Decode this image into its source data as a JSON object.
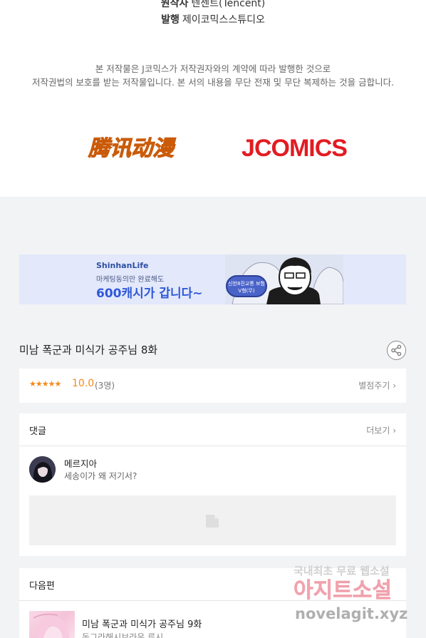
{
  "credits": {
    "author_label": "원작사",
    "author_value": "텐센트(Tencent)",
    "publisher_label": "발행",
    "publisher_value": "제이코믹스스튜디오"
  },
  "notice": {
    "line1": "본 저작물은 J코믹스가 저작권자와의 계약에 따라 발행한 것으로",
    "line2": "저작권법의 보호를 받는 저작물입니다. 본 서의 내용을 무단 전재 및 무단 복제하는 것을 금합니다."
  },
  "logos": {
    "tencent": "腾讯动漫",
    "jcomics": "JCOMICS"
  },
  "banner": {
    "brand": "ShinhanLife",
    "sub": "마케팅동의만 완료해도",
    "main": "600캐시가 갑니다~",
    "pill": "신한8진교통 보험V형(무)"
  },
  "episode": {
    "title": "미남 폭군과 미식가 공주님 8화"
  },
  "rating": {
    "stars": "★★★★★",
    "score": "10.0",
    "votes": "(3명)",
    "rate_link": "별점주기 ›"
  },
  "comments": {
    "header": "댓글",
    "more": "더보기 ›",
    "items": [
      {
        "name": "메르지아",
        "text": "세송이가 왜 저기서?"
      }
    ]
  },
  "next": {
    "header": "다음편",
    "title": "미남 폭군과 미식가 공주님 9화",
    "subtitle": "동그라해시브라운 루시"
  },
  "watermark": {
    "line1": "국내최초 무료 웹소설",
    "line2": "아지트소설",
    "line3": "novelagit.xyz"
  },
  "colors": {
    "accent_orange": "#f08a1d",
    "jcomics_red": "#e21b23",
    "tencent_orange": "#f07b17",
    "banner_blue": "#2f58d8"
  }
}
